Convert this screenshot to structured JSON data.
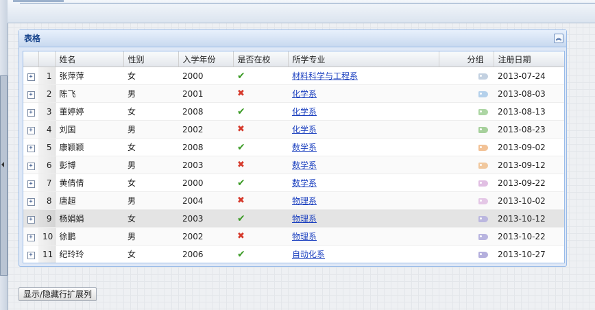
{
  "panel": {
    "title": "表格"
  },
  "columns": {
    "name": "姓名",
    "gender": "性别",
    "year": "入学年份",
    "enrolled": "是否在校",
    "major": "所学专业",
    "group": "分组",
    "date": "注册日期"
  },
  "rows": [
    {
      "num": "1",
      "name": "张萍萍",
      "gender": "女",
      "year": "2000",
      "enrolled": true,
      "major": "材料科学与工程系",
      "tag_color": "#b9c9dc",
      "date": "2013-07-24"
    },
    {
      "num": "2",
      "name": "陈飞",
      "gender": "男",
      "year": "2001",
      "enrolled": false,
      "major": "化学系",
      "tag_color": "#a9cbe9",
      "date": "2013-08-03"
    },
    {
      "num": "3",
      "name": "董婷婷",
      "gender": "女",
      "year": "2008",
      "enrolled": true,
      "major": "化学系",
      "tag_color": "#9fcf95",
      "date": "2013-08-13"
    },
    {
      "num": "4",
      "name": "刘国",
      "gender": "男",
      "year": "2002",
      "enrolled": false,
      "major": "化学系",
      "tag_color": "#98c98b",
      "date": "2013-08-23"
    },
    {
      "num": "5",
      "name": "康颖颖",
      "gender": "女",
      "year": "2008",
      "enrolled": true,
      "major": "数学系",
      "tag_color": "#f0b884",
      "date": "2013-09-02"
    },
    {
      "num": "6",
      "name": "彭博",
      "gender": "男",
      "year": "2003",
      "enrolled": false,
      "major": "数学系",
      "tag_color": "#f0c08f",
      "date": "2013-09-12"
    },
    {
      "num": "7",
      "name": "黄倩倩",
      "gender": "女",
      "year": "2000",
      "enrolled": true,
      "major": "数学系",
      "tag_color": "#dcb4df",
      "date": "2013-09-22"
    },
    {
      "num": "8",
      "name": "唐超",
      "gender": "男",
      "year": "2004",
      "enrolled": false,
      "major": "物理系",
      "tag_color": "#e1bfe3",
      "date": "2013-10-02"
    },
    {
      "num": "9",
      "name": "杨娟娟",
      "gender": "女",
      "year": "2003",
      "enrolled": true,
      "major": "物理系",
      "tag_color": "#b5b0df",
      "date": "2013-10-12",
      "selected": true
    },
    {
      "num": "10",
      "name": "徐鹏",
      "gender": "男",
      "year": "2002",
      "enrolled": false,
      "major": "物理系",
      "tag_color": "#aea9dc",
      "date": "2013-10-22"
    },
    {
      "num": "11",
      "name": "纪玲玲",
      "gender": "女",
      "year": "2006",
      "enrolled": true,
      "major": "自动化系",
      "tag_color": "#a8a2d8",
      "date": "2013-10-27"
    }
  ],
  "icons": {
    "expand": "plus-square-icon",
    "yes": "check-icon",
    "no": "cross-icon",
    "group": "tag-icon",
    "collapse": "double-chevron-up-icon"
  },
  "glyphs": {
    "expand": "+",
    "yes": "✔",
    "no": "✖",
    "collapse": "︽"
  },
  "toolbar": {
    "toggle_label": "显示/隐藏行扩展列"
  }
}
